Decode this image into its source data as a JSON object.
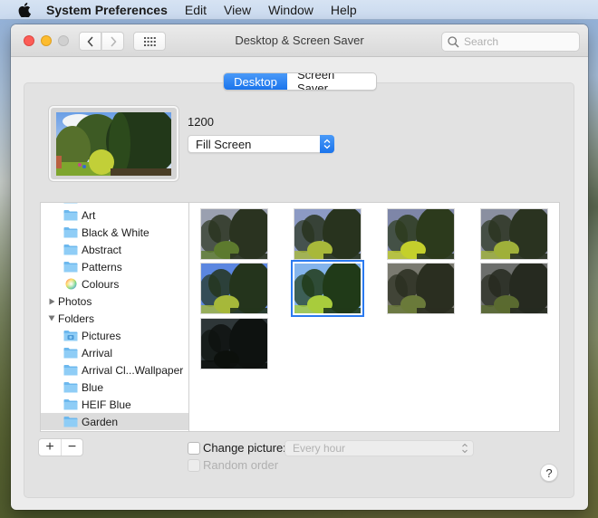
{
  "menubar": {
    "apple_icon": "apple-logo-icon",
    "app_name": "System Preferences",
    "items": [
      "Edit",
      "View",
      "Window",
      "Help"
    ]
  },
  "window": {
    "title": "Desktop & Screen Saver",
    "search": {
      "placeholder": "Search",
      "value": ""
    },
    "nav": {
      "back_icon": "chevron-left-icon",
      "forward_icon": "chevron-right-icon",
      "grid_icon": "grid-icon"
    }
  },
  "tabs": [
    {
      "label": "Desktop",
      "active": true
    },
    {
      "label": "Screen Saver",
      "active": false
    }
  ],
  "desktop": {
    "image_name": "1200",
    "fit_option": "Fill Screen"
  },
  "source_list": {
    "items": [
      {
        "label": "Art",
        "icon": "folder-icon",
        "level": 1
      },
      {
        "label": "Black & White",
        "icon": "folder-icon",
        "level": 1
      },
      {
        "label": "Abstract",
        "icon": "folder-icon",
        "level": 1
      },
      {
        "label": "Patterns",
        "icon": "folder-icon",
        "level": 1
      },
      {
        "label": "Colours",
        "icon": "color-wheel-icon",
        "level": 1
      },
      {
        "label": "Photos",
        "icon": "disclosure-right-icon",
        "level": 0,
        "expanded": false
      },
      {
        "label": "Folders",
        "icon": "disclosure-down-icon",
        "level": 0,
        "expanded": true
      },
      {
        "label": "Pictures",
        "icon": "pictures-folder-icon",
        "level": 1
      },
      {
        "label": "Arrival",
        "icon": "folder-icon",
        "level": 1
      },
      {
        "label": "Arrival Cl...Wallpaper",
        "icon": "folder-icon",
        "level": 1
      },
      {
        "label": "Blue",
        "icon": "folder-icon",
        "level": 1
      },
      {
        "label": "HEIF Blue",
        "icon": "folder-icon",
        "level": 1
      },
      {
        "label": "Garden",
        "icon": "folder-icon",
        "level": 1,
        "selected": true
      }
    ]
  },
  "thumbnails": [
    {
      "tone": "dusk-1",
      "sky": "#9aa0b0",
      "tree": "#2a3320",
      "grass": "#5d7a2e",
      "selected": false
    },
    {
      "tone": "dusk-2",
      "sky": "#8c9ac4",
      "tree": "#28331e",
      "grass": "#a8b83a",
      "selected": false
    },
    {
      "tone": "dusk-3",
      "sky": "#7e86a8",
      "tree": "#2c3a1c",
      "grass": "#c4cf2c",
      "selected": false
    },
    {
      "tone": "dusk-4",
      "sky": "#8a8fa0",
      "tree": "#2a3320",
      "grass": "#9fb03a",
      "selected": false
    },
    {
      "tone": "morning",
      "sky": "#5b86e0",
      "tree": "#24341c",
      "grass": "#a6b83a",
      "selected": false
    },
    {
      "tone": "midday",
      "sky": "#84b4ec",
      "tree": "#203a18",
      "grass": "#a8cc3c",
      "selected": true
    },
    {
      "tone": "evening-1",
      "sky": "#7a7a70",
      "tree": "#2a2e20",
      "grass": "#6a7a3a",
      "selected": false
    },
    {
      "tone": "evening-2",
      "sky": "#6c6e6c",
      "tree": "#262a20",
      "grass": "#5a6a30",
      "selected": false
    },
    {
      "tone": "night",
      "sky": "#2e3638",
      "tree": "#0e1210",
      "grass": "#0c100c",
      "selected": false
    }
  ],
  "footer": {
    "add_label": "+",
    "remove_label": "−",
    "change_picture_label": "Change picture:",
    "change_picture_checked": false,
    "interval": "Every hour",
    "random_order_label": "Random order",
    "random_order_checked": false,
    "help_label": "?"
  }
}
